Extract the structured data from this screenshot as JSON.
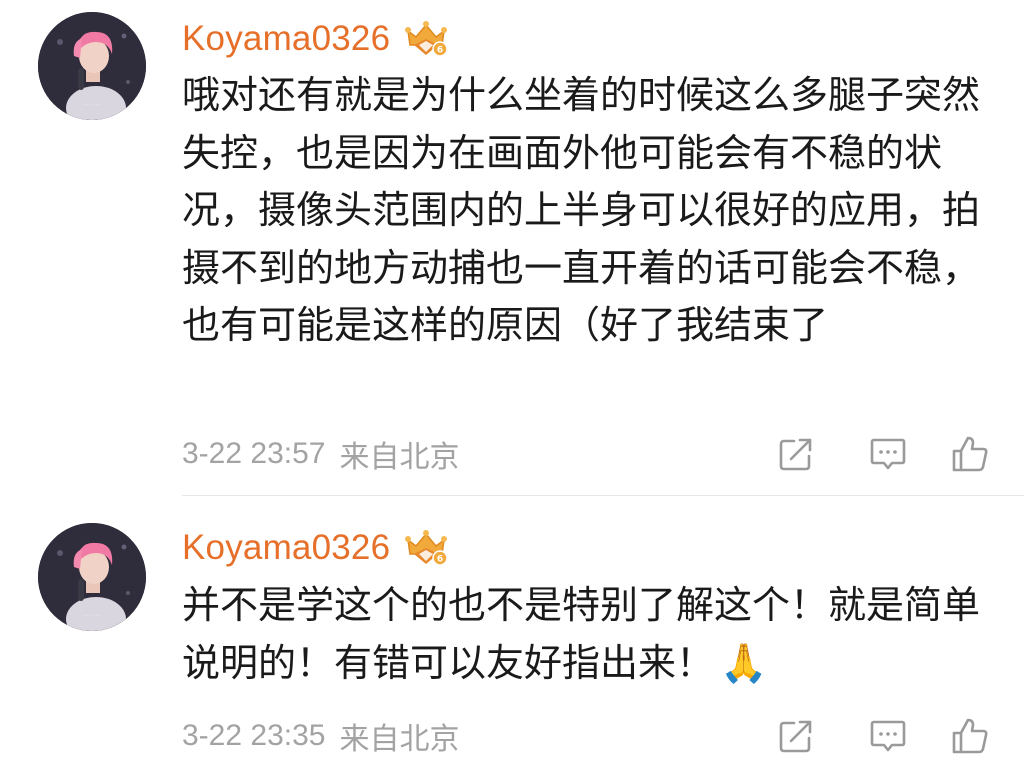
{
  "comments": [
    {
      "username": "Koyama0326",
      "content": "哦对还有就是为什么坐着的时候这么多腿子突然失控，也是因为在画面外他可能会有不稳的状况，摄像头范围内的上半身可以很好的应用，拍摄不到的地方动捕也一直开着的话可能会不稳，也有可能是这样的原因（好了我结束了",
      "timestamp": "3-22 23:57",
      "location": "来自北京"
    },
    {
      "username": "Koyama0326",
      "content": "并不是学这个的也不是特别了解这个！就是简单说明的！有错可以友好指出来！",
      "emoji": "🙏",
      "timestamp": "3-22 23:35",
      "location": "来自北京"
    }
  ],
  "icons": {
    "badge": "crown-badge-icon",
    "share": "share-icon",
    "reply": "comment-icon",
    "like": "thumbs-up-icon"
  },
  "colors": {
    "username": "#e6702a",
    "text": "#1a1a1a",
    "meta": "#a3a3a3",
    "icon": "#9a9a9a",
    "badge_gold": "#f2a93b"
  }
}
